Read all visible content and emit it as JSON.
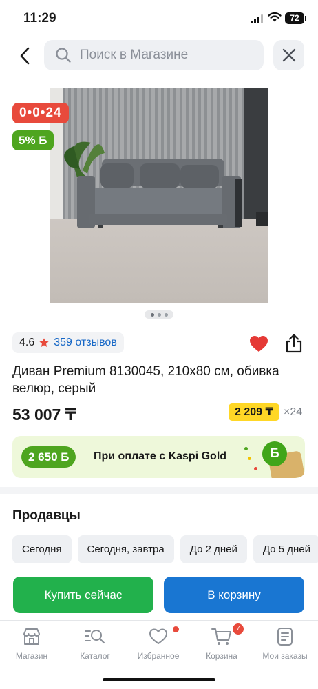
{
  "status_bar": {
    "time": "11:29",
    "battery": "72"
  },
  "header": {
    "search_placeholder": "Поиск в Магазине"
  },
  "badges": {
    "timer": "0•0•24",
    "bonus": "5% Б"
  },
  "gallery": {
    "page_count": 3,
    "current_page": 1
  },
  "rating": {
    "value": "4.6",
    "reviews": "359 отзывов"
  },
  "product": {
    "title": "Диван Premium 8130045, 210x80 см, обивка велюр, серый",
    "price": "53 007 ₸",
    "installment_amount": "2 209 ₸",
    "installment_months": "×24"
  },
  "kaspi_gold": {
    "bonus": "2 650 Б",
    "text": "При оплате с Kaspi Gold",
    "coin_letter": "Б"
  },
  "sellers": {
    "heading": "Продавцы",
    "filters": [
      "Сегодня",
      "Сегодня, завтра",
      "До 2 дней",
      "До 5 дней"
    ]
  },
  "actions": {
    "buy_now": "Купить сейчас",
    "add_to_cart": "В корзину"
  },
  "tabbar": {
    "items": [
      {
        "label": "Магазин",
        "icon": "shop-icon"
      },
      {
        "label": "Каталог",
        "icon": "catalog-search-icon"
      },
      {
        "label": "Избранное",
        "icon": "heart-outline-icon"
      },
      {
        "label": "Корзина",
        "icon": "cart-icon",
        "badge": "7"
      },
      {
        "label": "Мои заказы",
        "icon": "orders-icon"
      }
    ]
  },
  "colors": {
    "timer_badge": "#e84a3c",
    "bonus_green": "#4ea51f",
    "installment_yellow": "#ffd726",
    "buy_button": "#22b14c",
    "cart_button": "#1976d2",
    "link_blue": "#1667c6",
    "favorite_heart": "#e53935"
  }
}
